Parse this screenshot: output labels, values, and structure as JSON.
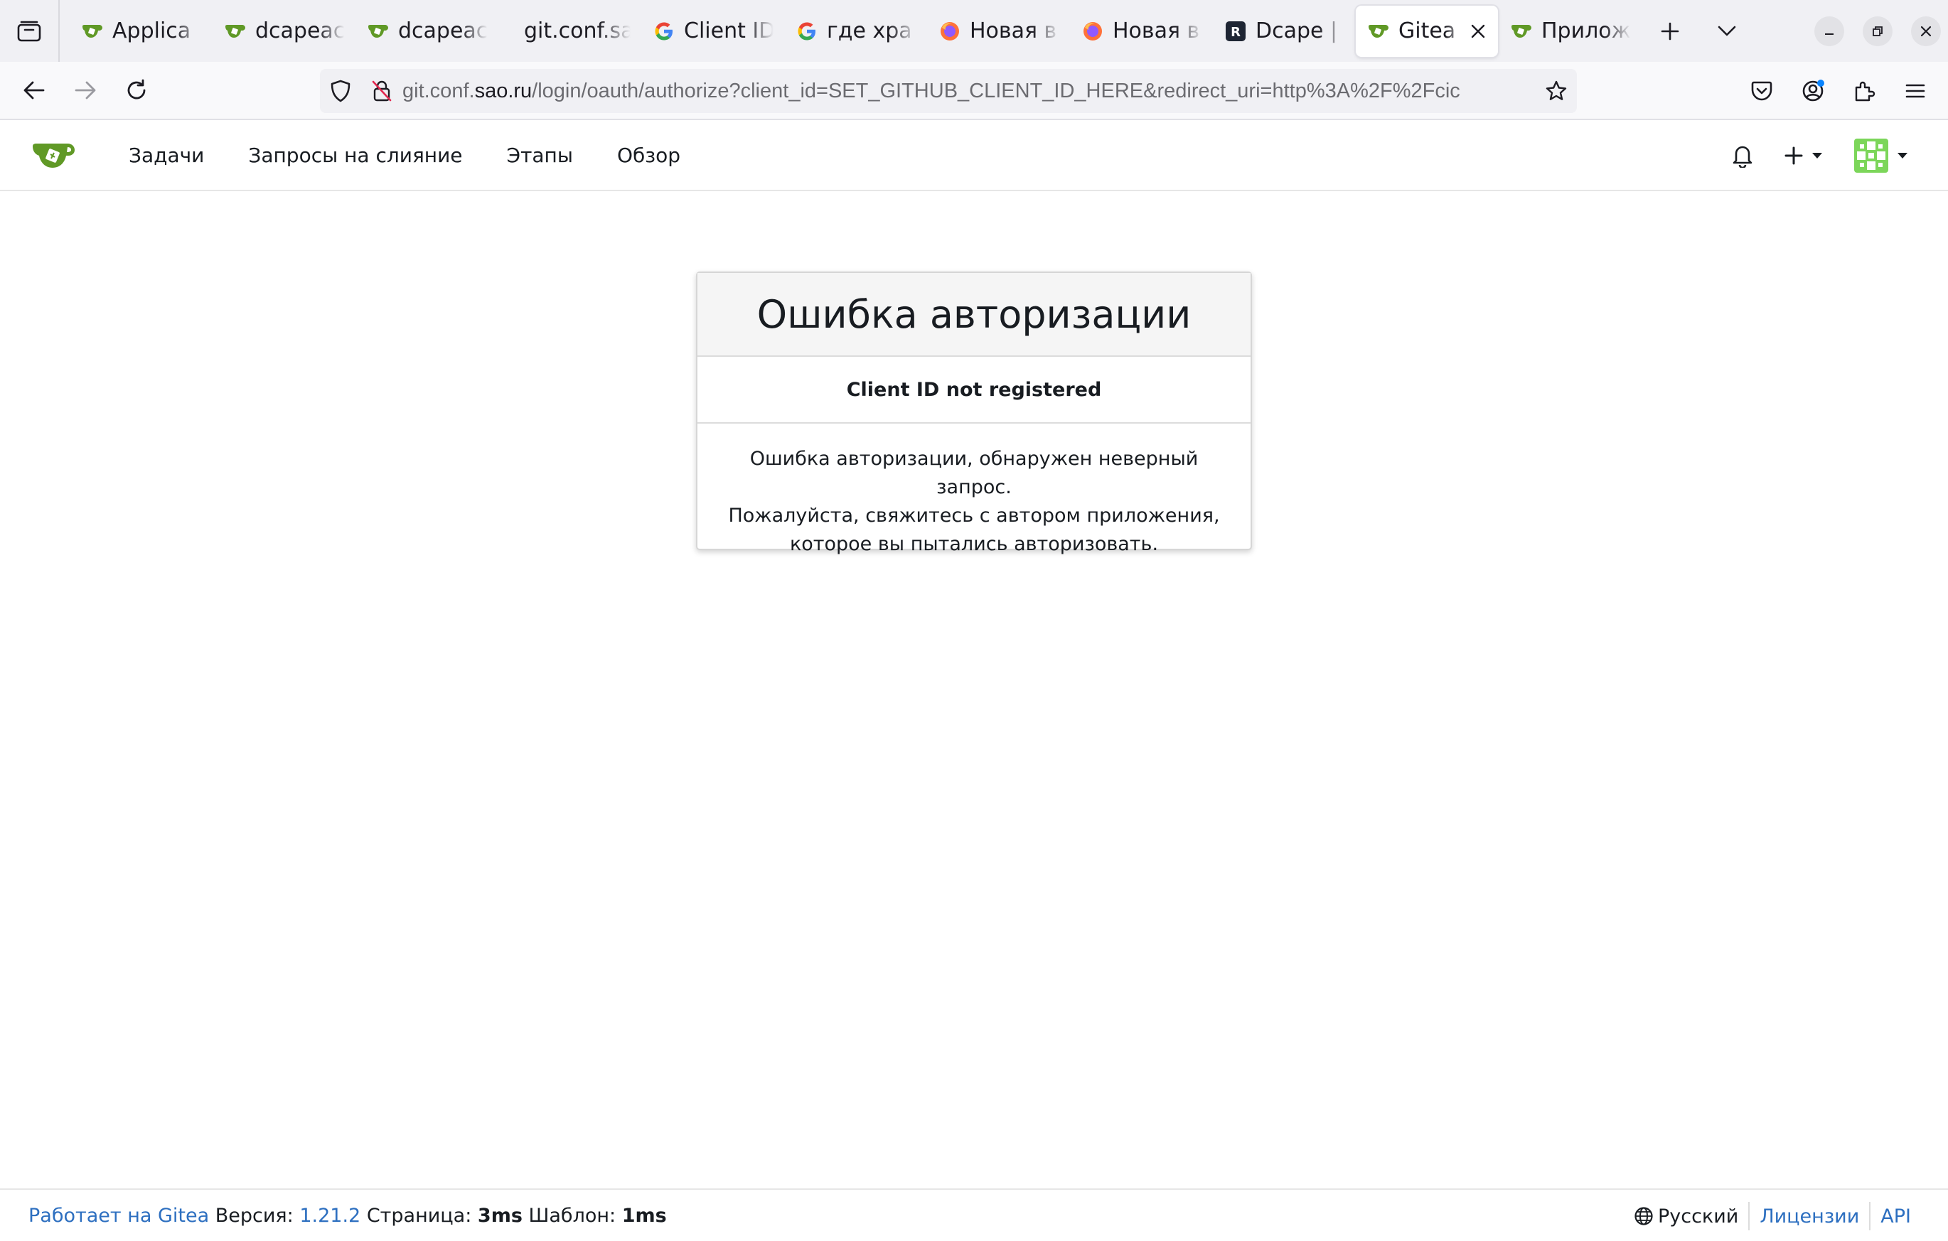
{
  "browser": {
    "tabs": [
      {
        "title": "Applica",
        "favicon": "gitea-icon"
      },
      {
        "title": "dcapeac",
        "favicon": "gitea-icon"
      },
      {
        "title": "dcapeac",
        "favicon": "gitea-icon"
      },
      {
        "title": "git.conf.sao",
        "favicon": "none"
      },
      {
        "title": "Client ID",
        "favicon": "google-icon"
      },
      {
        "title": "где хра",
        "favicon": "google-icon"
      },
      {
        "title": "Новая в",
        "favicon": "firefox-icon"
      },
      {
        "title": "Новая в",
        "favicon": "firefox-icon"
      },
      {
        "title": "Dcape |",
        "favicon": "r-icon"
      },
      {
        "title": "Gitea",
        "favicon": "gitea-icon",
        "active": true
      },
      {
        "title": "Прилож",
        "favicon": "gitea-icon"
      }
    ],
    "url": {
      "prefix": "git.conf.",
      "host": "sao.ru",
      "path": "/login/oauth/authorize?client_id=SET_GITHUB_CLIENT_ID_HERE&redirect_uri=http%3A%2F%2Fcic"
    }
  },
  "gitea": {
    "nav": {
      "issues": "Задачи",
      "pulls": "Запросы на слияние",
      "milestones": "Этапы",
      "explore": "Обзор"
    }
  },
  "error": {
    "title": "Ошибка авторизации",
    "subtitle": "Client ID not registered",
    "message_lines": [
      "Ошибка авторизации, обнаружен неверный запрос.",
      "Пожалуйста, свяжитесь с автором приложения,",
      "которое вы пытались авторизовать."
    ]
  },
  "footer": {
    "powered_by": "Работает на Gitea",
    "version_label": "Версия:",
    "version": "1.21.2",
    "page_label": "Страница:",
    "page_time": "3ms",
    "template_label": "Шаблон:",
    "template_time": "1ms",
    "language": "Русский",
    "licenses": "Лицензии",
    "api": "API"
  },
  "colors": {
    "gitea_green": "#609926",
    "link_blue": "#2d6fc0"
  }
}
